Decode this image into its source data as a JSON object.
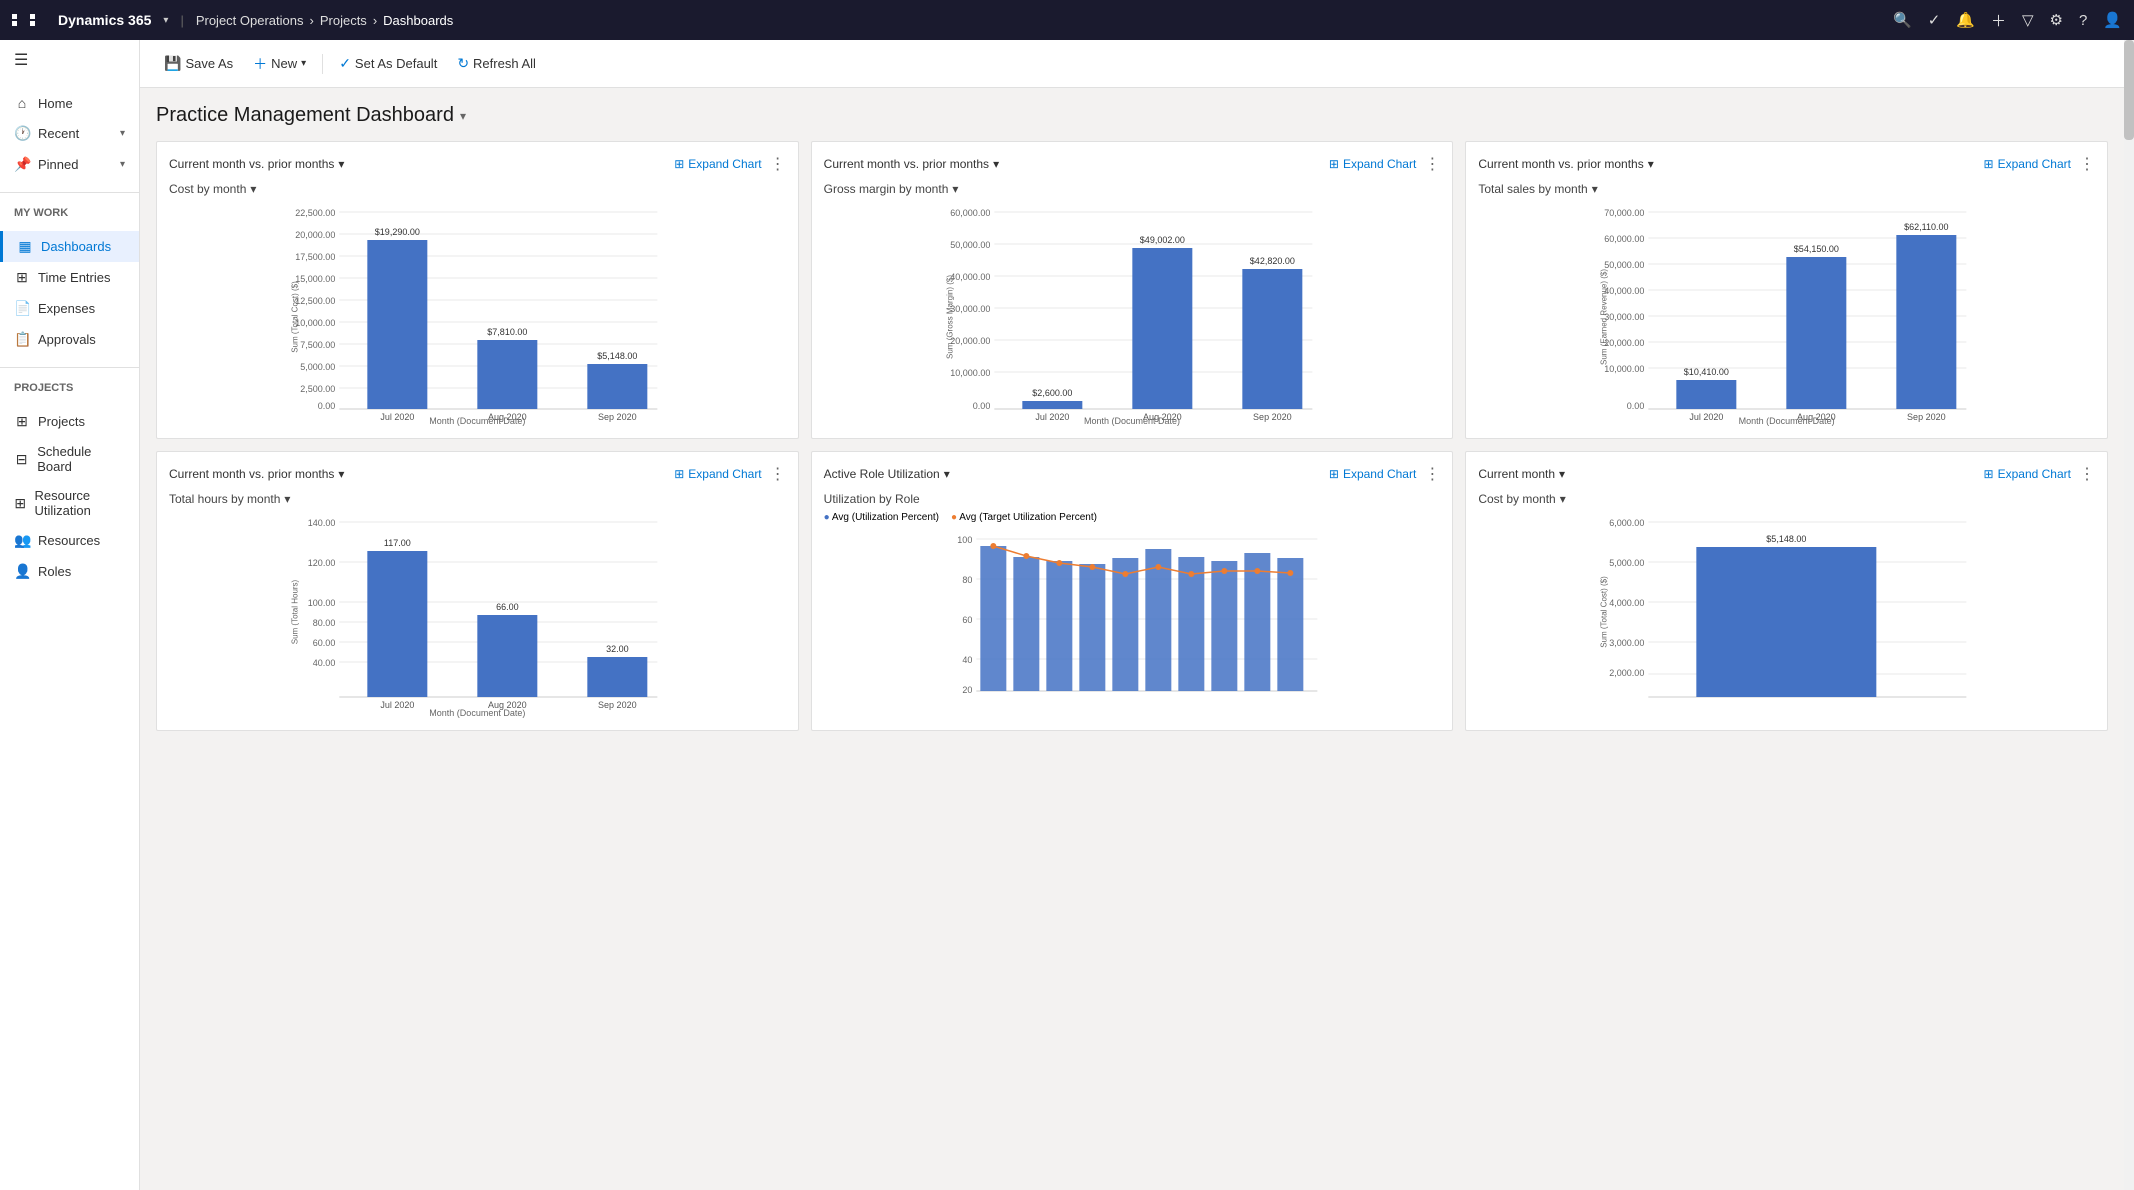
{
  "topNav": {
    "brand": "Dynamics 365",
    "breadcrumbs": [
      "Project Operations",
      "Projects",
      "Dashboards"
    ],
    "icons": [
      "search",
      "checklist",
      "bell",
      "plus",
      "filter",
      "settings",
      "help",
      "user"
    ]
  },
  "sidebar": {
    "hamburger": "☰",
    "myWork": {
      "label": "My Work",
      "items": [
        {
          "id": "home",
          "label": "Home",
          "icon": "⌂"
        },
        {
          "id": "recent",
          "label": "Recent",
          "icon": "🕐",
          "hasChevron": true
        },
        {
          "id": "pinned",
          "label": "Pinned",
          "icon": "📌",
          "hasChevron": true
        }
      ]
    },
    "myWorkSection": {
      "label": "My Work",
      "items": [
        {
          "id": "dashboards",
          "label": "Dashboards",
          "icon": "▦",
          "active": true
        },
        {
          "id": "time-entries",
          "label": "Time Entries",
          "icon": "⊞"
        },
        {
          "id": "expenses",
          "label": "Expenses",
          "icon": "📄"
        },
        {
          "id": "approvals",
          "label": "Approvals",
          "icon": "📋"
        }
      ]
    },
    "projectsSection": {
      "label": "Projects",
      "items": [
        {
          "id": "projects",
          "label": "Projects",
          "icon": "⊞"
        },
        {
          "id": "schedule-board",
          "label": "Schedule Board",
          "icon": "⊟"
        },
        {
          "id": "resource-utilization",
          "label": "Resource Utilization",
          "icon": "⊞"
        },
        {
          "id": "resources",
          "label": "Resources",
          "icon": "👥"
        },
        {
          "id": "roles",
          "label": "Roles",
          "icon": "👤"
        }
      ]
    }
  },
  "toolbar": {
    "saveAs": "Save As",
    "new": "New",
    "setAsDefault": "Set As Default",
    "refreshAll": "Refresh All"
  },
  "dashboard": {
    "title": "Practice Management Dashboard",
    "charts": [
      {
        "id": "cost-by-month",
        "filterLabel": "Current month vs. prior months",
        "subtitle": "Cost by month",
        "expandLabel": "Expand Chart",
        "yLabel": "Sum (Total Cost) ($)",
        "xLabel": "Month (Document Date)",
        "yMax": 22500,
        "yTicks": [
          "22,500.00",
          "20,000.00",
          "17,500.00",
          "15,000.00",
          "12,500.00",
          "10,000.00",
          "7,500.00",
          "5,000.00",
          "2,500.00",
          "0.00"
        ],
        "bars": [
          {
            "month": "Jul 2020",
            "value": 19290,
            "label": "$19,290.00"
          },
          {
            "month": "Aug 2020",
            "value": 7810,
            "label": "$7,810.00"
          },
          {
            "month": "Sep 2020",
            "value": 5148,
            "label": "$5,148.00"
          }
        ]
      },
      {
        "id": "gross-margin-by-month",
        "filterLabel": "Current month vs. prior months",
        "subtitle": "Gross margin by month",
        "expandLabel": "Expand Chart",
        "yLabel": "Sum (Gross Margin) ($)",
        "xLabel": "Month (Document Date)",
        "yMax": 60000,
        "yTicks": [
          "60,000.00",
          "50,000.00",
          "40,000.00",
          "30,000.00",
          "20,000.00",
          "10,000.00",
          "0.00"
        ],
        "bars": [
          {
            "month": "Jul 2020",
            "value": 2600,
            "label": "$2,600.00"
          },
          {
            "month": "Aug 2020",
            "value": 49002,
            "label": "$49,002.00"
          },
          {
            "month": "Sep 2020",
            "value": 42820,
            "label": "$42,820.00"
          }
        ]
      },
      {
        "id": "total-sales-by-month",
        "filterLabel": "Current month vs. prior months",
        "subtitle": "Total sales by month",
        "expandLabel": "Expand Chart",
        "yLabel": "Sum (Earned Revenue) ($)",
        "xLabel": "Month (Document Date)",
        "yMax": 70000,
        "yTicks": [
          "70,000.00",
          "60,000.00",
          "50,000.00",
          "40,000.00",
          "30,000.00",
          "20,000.00",
          "10,000.00",
          "0.00"
        ],
        "bars": [
          {
            "month": "Jul 2020",
            "value": 10410,
            "label": "$10,410.00"
          },
          {
            "month": "Aug 2020",
            "value": 54150,
            "label": "$54,150.00"
          },
          {
            "month": "Sep 2020",
            "value": 62110,
            "label": "$62,110.00"
          }
        ]
      },
      {
        "id": "total-hours-by-month",
        "filterLabel": "Current month vs. prior months",
        "subtitle": "Total hours by month",
        "expandLabel": "Expand Chart",
        "yLabel": "Sum (Total Hours)",
        "xLabel": "Month (Document Date)",
        "yMax": 140,
        "yTicks": [
          "140.00",
          "120.00",
          "100.00",
          "80.00",
          "60.00",
          "40.00"
        ],
        "bars": [
          {
            "month": "Jul 2020",
            "value": 117,
            "label": "117.00"
          },
          {
            "month": "Aug 2020",
            "value": 66,
            "label": "66.00"
          },
          {
            "month": "Sep 2020",
            "value": 32,
            "label": "32.00"
          }
        ]
      },
      {
        "id": "active-role-utilization",
        "filterLabel": "Active Role Utilization",
        "subtitle": "Utilization by Role",
        "expandLabel": "Expand Chart",
        "legend": [
          {
            "color": "#4472c4",
            "label": "Avg (Utilization Percent)"
          },
          {
            "color": "#ed7d31",
            "label": "Avg (Target Utilization Percent)"
          }
        ],
        "yTicks": [
          "100",
          "80",
          "60",
          "40",
          "20"
        ],
        "bars": [
          95,
          88,
          85,
          83,
          87,
          93,
          88,
          85,
          90,
          87
        ],
        "line": [
          93,
          88,
          82,
          80,
          76,
          80,
          76,
          78,
          78,
          77
        ]
      },
      {
        "id": "cost-by-month-2",
        "filterLabel": "Current month",
        "subtitle": "Cost by month",
        "expandLabel": "Expand Chart",
        "yLabel": "Sum (Total Cost) ($)",
        "xLabel": "",
        "yMax": 6000,
        "yTicks": [
          "6,000.00",
          "5,000.00",
          "4,000.00",
          "3,000.00",
          "2,000.00"
        ],
        "bars": [
          {
            "month": "",
            "value": 5148,
            "label": "$5,148.00"
          }
        ]
      }
    ]
  }
}
